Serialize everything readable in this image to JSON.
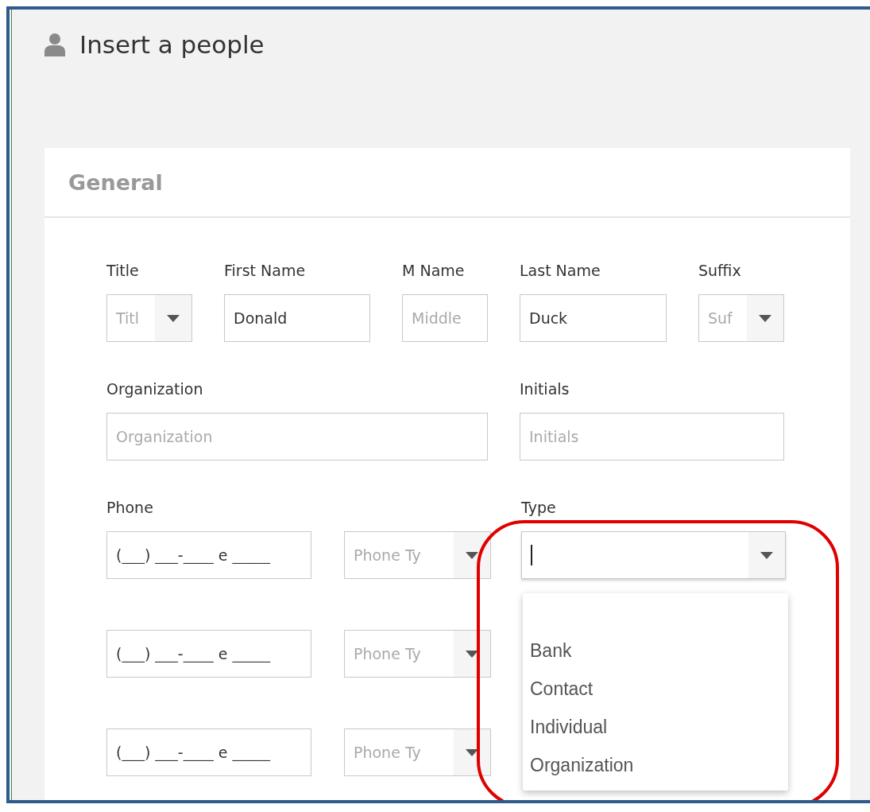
{
  "page": {
    "title": "Insert a people"
  },
  "section": {
    "title": "General"
  },
  "name_fields": [
    {
      "kind": "select",
      "label": "Title",
      "placeholder": "Titl"
    },
    {
      "kind": "input",
      "label": "First Name",
      "value": "Donald"
    },
    {
      "kind": "input",
      "label": "M Name",
      "placeholder": "Middle"
    },
    {
      "kind": "input",
      "label": "Last Name",
      "value": "Duck"
    },
    {
      "kind": "select",
      "label": "Suffix",
      "placeholder": "Suf"
    }
  ],
  "org_fields": [
    {
      "kind": "input",
      "label": "Organization",
      "placeholder": "Organization"
    },
    {
      "kind": "input",
      "label": "Initials",
      "placeholder": "Initials"
    }
  ],
  "phone": {
    "label": "Phone",
    "rows": [
      {
        "value": "(___) ___-____ e _____",
        "type_placeholder": "Phone Ty"
      },
      {
        "value": "(___) ___-____ e _____",
        "type_placeholder": "Phone Ty"
      },
      {
        "value": "(___) ___-____ e _____",
        "type_placeholder": "Phone Ty"
      }
    ]
  },
  "type": {
    "label": "Type",
    "focused": true,
    "expanded": true,
    "options": [
      "Bank",
      "Contact",
      "Individual",
      "Organization"
    ]
  }
}
